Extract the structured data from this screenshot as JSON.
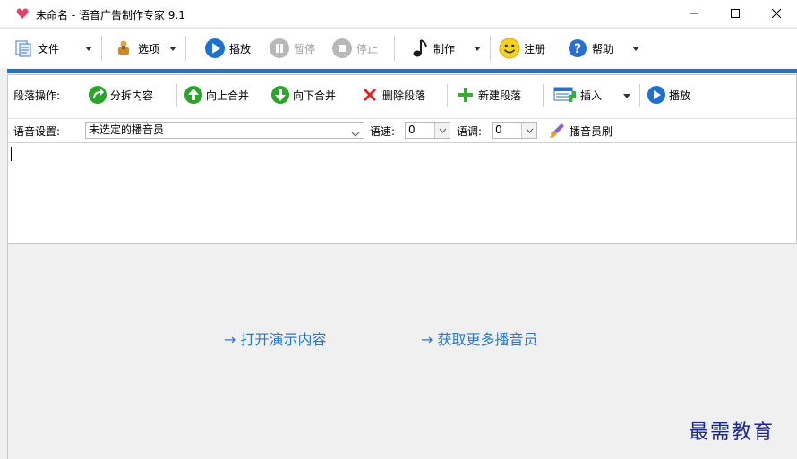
{
  "window": {
    "title": "未命名 - 语音广告制作专家 9.1",
    "minimize_icon": "minimize-icon",
    "maximize_icon": "maximize-icon",
    "close_icon": "close-icon"
  },
  "toolbar": {
    "file": "文件",
    "options": "选项",
    "play": "播放",
    "pause": "暂停",
    "stop": "停止",
    "make": "制作",
    "register": "注册",
    "help": "帮助"
  },
  "paragraph_bar": {
    "label": "段落操作:",
    "split": "分拆内容",
    "merge_up": "向上合并",
    "merge_down": "向下合并",
    "delete": "删除段落",
    "new": "新建段落",
    "insert": "插入",
    "play": "播放"
  },
  "voice_bar": {
    "label": "语音设置:",
    "voice_value": "未选定的播音员",
    "speed_label": "语速:",
    "speed_value": "0",
    "pitch_label": "语调:",
    "pitch_value": "0",
    "brush": "播音员刷"
  },
  "links": {
    "open_demo": "→ 打开演示内容",
    "get_more": "→ 获取更多播音员"
  },
  "watermark": "最需教育",
  "colors": {
    "accent_blue": "#1878d0",
    "link_blue": "#2b78c8",
    "green": "#2aa52a",
    "heart": "#e8406a"
  }
}
